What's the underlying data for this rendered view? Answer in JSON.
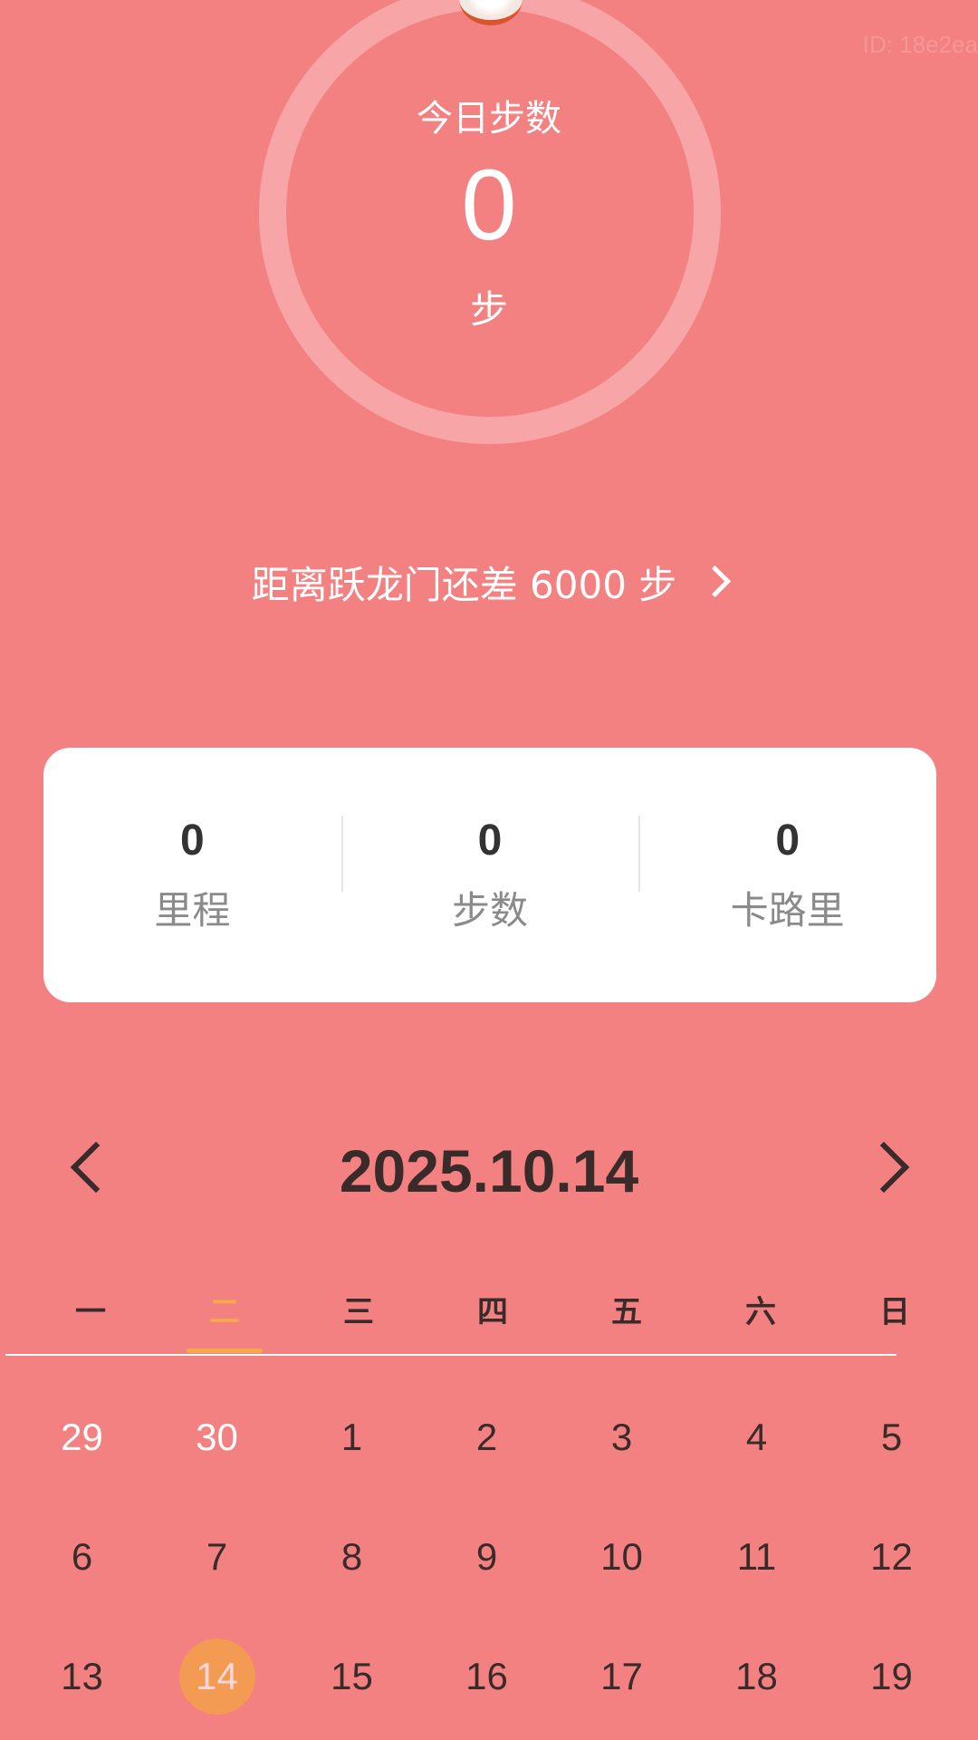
{
  "watermark": "ID: 18e2ea",
  "ring": {
    "title": "今日步数",
    "steps": "0",
    "unit": "步"
  },
  "goal": {
    "text": "距离跃龙门还差 6000 步"
  },
  "stats": [
    {
      "value": "0",
      "label": "里程"
    },
    {
      "value": "0",
      "label": "步数"
    },
    {
      "value": "0",
      "label": "卡路里"
    }
  ],
  "calendar": {
    "date": "2025.10.14",
    "weekdays": [
      "一",
      "二",
      "三",
      "四",
      "五",
      "六",
      "日"
    ],
    "active_weekday": 1,
    "days": [
      {
        "n": "29",
        "prev": true
      },
      {
        "n": "30",
        "prev": true
      },
      {
        "n": "1"
      },
      {
        "n": "2"
      },
      {
        "n": "3"
      },
      {
        "n": "4"
      },
      {
        "n": "5"
      },
      {
        "n": "6"
      },
      {
        "n": "7"
      },
      {
        "n": "8"
      },
      {
        "n": "9"
      },
      {
        "n": "10"
      },
      {
        "n": "11"
      },
      {
        "n": "12"
      },
      {
        "n": "13"
      },
      {
        "n": "14",
        "today": true
      },
      {
        "n": "15"
      },
      {
        "n": "16"
      },
      {
        "n": "17"
      },
      {
        "n": "18"
      },
      {
        "n": "19"
      }
    ]
  }
}
